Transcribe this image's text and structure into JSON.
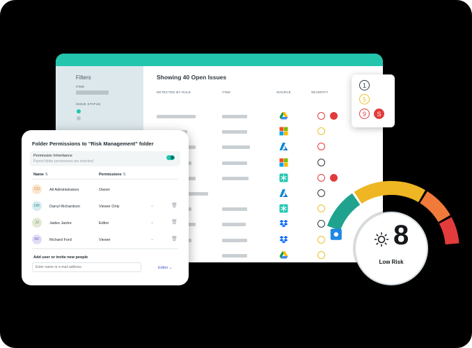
{
  "filters": {
    "title": "Filters",
    "item_label": "ITEM",
    "issue_status_label": "ISSUE STATUS"
  },
  "issues": {
    "title": "Showing 40 Open Issues",
    "columns": [
      "DETECTED BY RULE",
      "ITEM",
      "SOURCE",
      "SEVERITY"
    ],
    "rows": [
      {
        "source": "google-drive-icon",
        "severity": [
          "red-outline",
          "red-filled"
        ]
      },
      {
        "source": "microsoft-office-icon",
        "severity": [
          "yellow-outline"
        ]
      },
      {
        "source": "azure-icon",
        "severity": [
          "red-outline"
        ]
      },
      {
        "source": "microsoft-office-icon",
        "severity": [
          "black-outline"
        ]
      },
      {
        "source": "atlassian-confluence-icon",
        "severity": [
          "red-outline",
          "red-filled"
        ]
      },
      {
        "source": "azure-icon",
        "severity": [
          "black-outline"
        ]
      },
      {
        "source": "atlassian-confluence-icon",
        "severity": [
          "yellow-outline"
        ]
      },
      {
        "source": "dropbox-icon",
        "severity": [
          "black-outline",
          "red-filled"
        ]
      },
      {
        "source": "dropbox-icon",
        "severity": [
          "yellow-outline"
        ]
      },
      {
        "source": "google-drive-icon",
        "severity": [
          "yellow-outline"
        ]
      }
    ]
  },
  "severity_legend": {
    "items": [
      {
        "label": "1",
        "color": "#2d3a44",
        "style": "outline"
      },
      {
        "label": "5",
        "color": "#e8c22c",
        "style": "outline"
      },
      {
        "label": "9",
        "color": "#e23b3b",
        "style": "outline"
      },
      {
        "label": "S",
        "color": "#e23b3b",
        "style": "filled"
      }
    ]
  },
  "permissions": {
    "title": "Folder Permissions to \"Risk Management\" folder",
    "inheritance_title": "Permission Inheritance",
    "inheritance_sub": "Parent folder permissions are inherited",
    "col_name": "Name",
    "col_permissions": "Permissions",
    "users": [
      {
        "initials": "CD",
        "name": "All Administrators",
        "permission": "Owner",
        "avatar_bg": "#fbe6cf",
        "avatar_fg": "#c98a3e",
        "editable": false
      },
      {
        "initials": "DR",
        "name": "Darryl Richardson",
        "permission": "Viewer Only",
        "avatar_bg": "#d3ecef",
        "avatar_fg": "#3a8a95",
        "editable": true
      },
      {
        "initials": "JJ",
        "name": "Jadeo Jantre",
        "permission": "Editor",
        "avatar_bg": "#e1e9d6",
        "avatar_fg": "#6e8a4c",
        "editable": true
      },
      {
        "initials": "RF",
        "name": "Richard Ford",
        "permission": "Viewer",
        "avatar_bg": "#e3dcf6",
        "avatar_fg": "#6f5cc4",
        "editable": true
      }
    ],
    "add_label": "Add user or invite new people",
    "invite_placeholder": "Enter name or e-mail address",
    "invite_role": "Editor"
  },
  "risk": {
    "score": "8",
    "label": "Low Risk"
  },
  "colors": {
    "accent": "#23c5ad",
    "red": "#e23b3b",
    "yellow": "#e8c22c"
  }
}
